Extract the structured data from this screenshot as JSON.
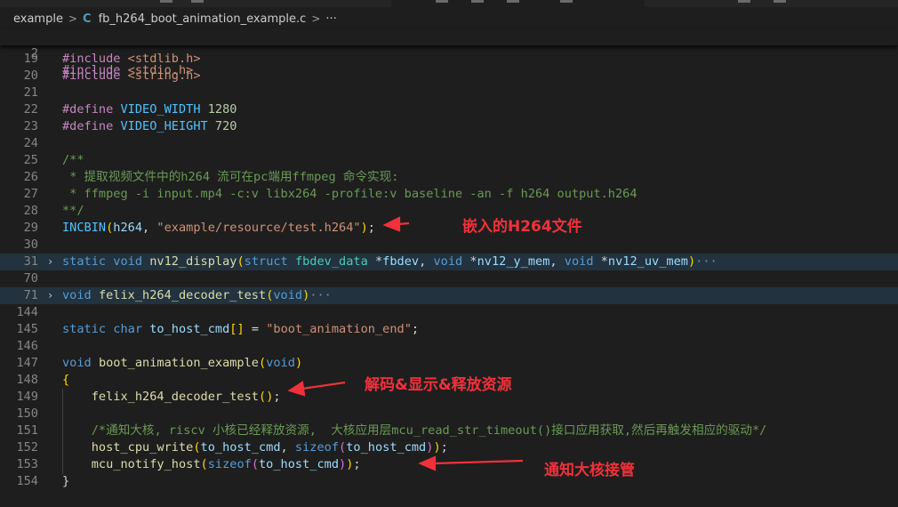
{
  "breadcrumb": {
    "folder": "example",
    "file_icon": "C",
    "file": "fb_h264_boot_animation_example.c",
    "more": "···"
  },
  "sticky_line": {
    "num": "2",
    "code": "#include <stdio.h>"
  },
  "lines": [
    {
      "num": "19",
      "code": "#include <stdlib.h>"
    },
    {
      "num": "20",
      "code": "#include <string.h>"
    },
    {
      "num": "21",
      "code": ""
    },
    {
      "num": "22",
      "code": "#define VIDEO_WIDTH 1280"
    },
    {
      "num": "23",
      "code": "#define VIDEO_HEIGHT 720"
    },
    {
      "num": "24",
      "code": ""
    },
    {
      "num": "25",
      "code": "/**"
    },
    {
      "num": "26",
      "code": " * 提取视频文件中的h264 流可在pc端用ffmpeg 命令实现:"
    },
    {
      "num": "27",
      "code": " * ffmpeg -i input.mp4 -c:v libx264 -profile:v baseline -an -f h264 output.h264"
    },
    {
      "num": "28",
      "code": "**/"
    },
    {
      "num": "29",
      "code": "INCBIN(h264, \"example/resource/test.h264\");"
    },
    {
      "num": "30",
      "code": ""
    },
    {
      "num": "31",
      "code": "static void nv12_display(struct fbdev_data *fbdev, void *nv12_y_mem, void *nv12_uv_mem)···",
      "folded": true
    },
    {
      "num": "70",
      "code": ""
    },
    {
      "num": "71",
      "code": "void felix_h264_decoder_test(void)···",
      "folded": true
    },
    {
      "num": "144",
      "code": ""
    },
    {
      "num": "145",
      "code": "static char to_host_cmd[] = \"boot_animation_end\";"
    },
    {
      "num": "146",
      "code": ""
    },
    {
      "num": "147",
      "code": "void boot_animation_example(void)"
    },
    {
      "num": "148",
      "code": "{"
    },
    {
      "num": "149",
      "code": "    felix_h264_decoder_test();"
    },
    {
      "num": "150",
      "code": ""
    },
    {
      "num": "151",
      "code": "    /*通知大核, riscv 小核已经释放资源,  大核应用层mcu_read_str_timeout()接口应用获取,然后再触发相应的驱动*/"
    },
    {
      "num": "152",
      "code": "    host_cpu_write(to_host_cmd, sizeof(to_host_cmd));"
    },
    {
      "num": "153",
      "code": "    mcu_notify_host(sizeof(to_host_cmd));"
    },
    {
      "num": "154",
      "code": "}"
    }
  ],
  "annotations": {
    "embed": "嵌入的H264文件",
    "decode": "解码&显示&释放资源",
    "notify": "通知大核接管"
  },
  "colors": {
    "background": "#1e1e1e",
    "annotation": "#f0313b",
    "keyword": "#569cd6",
    "string": "#ce9178",
    "comment": "#6a9955",
    "function": "#dcdcaa"
  }
}
